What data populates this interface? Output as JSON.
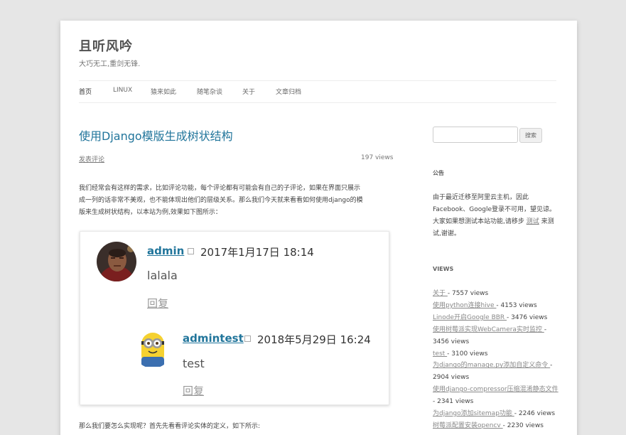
{
  "site": {
    "title": "且听风吟",
    "description": "大巧无工,重剑无锋."
  },
  "nav": [
    {
      "label": "首页"
    },
    {
      "label": "LINUX"
    },
    {
      "label": "猿来如此"
    },
    {
      "label": "随笔杂谈"
    },
    {
      "label": "关于"
    },
    {
      "label": "文章归档"
    }
  ],
  "post": {
    "title": "使用Django模版生成树状结构",
    "comments_link": "发表评论",
    "views": "197 views",
    "intro_lines": [
      "我们经常会有这样的需求，比如评论功能，每个评论都有可能会有自己的子评论，如果在界面只展示",
      "成一列的话非常不美观，也不能体现出他们的层级关系。那么我们今天就来看看如何使用django的模",
      "版来生成树状结构，以本站为例,效果如下图所示："
    ],
    "next_paragraph": "那么我们要怎么实现呢？首先先看看评论实体的定义，如下所示:"
  },
  "demo_comments": [
    {
      "author": "admin",
      "date": "2017年1月17日 18:14",
      "text": "lalala",
      "reply": "回复"
    },
    {
      "author": "admintest",
      "date": "2018年5月29日 16:24",
      "text": "test",
      "reply": "回复"
    }
  ],
  "sidebar": {
    "search_button": "搜索",
    "notice_title": "公告",
    "notice_lines": [
      "由于最近迁移至阿里云主机，因此",
      "Facebook、Google登录不可用，望见谅。"
    ],
    "notice_line3_prefix": "大家如果想测试本站功能,请移步 ",
    "notice_link": "测试",
    "notice_line3_suffix": " 来测",
    "notice_line4": "试,谢谢。",
    "views_title": "VIEWS",
    "views_items": [
      {
        "link": "关于 ",
        "count": " - 7557 views"
      },
      {
        "link": "使用python连接hive ",
        "count": " - 4153 views"
      },
      {
        "link": "Linode开启Google BBR ",
        "count": " - 3476 views"
      },
      {
        "link": "使用树莓派实现WebCamera实时监控 ",
        "count": " -"
      },
      {
        "link": "",
        "count": "3456 views"
      },
      {
        "link": "test ",
        "count": " - 3100 views"
      },
      {
        "link": "为django的manage.py添加自定义命令 ",
        "count": " -"
      },
      {
        "link": "",
        "count": "2904 views"
      },
      {
        "link": "使用django-compressor压缩混淆静态文件 ",
        "count": ""
      },
      {
        "link": "",
        "count": " - 2341 views"
      },
      {
        "link": "为django添加sitemap功能 ",
        "count": " - 2246 views"
      },
      {
        "link": "树莓派配置安装opencv ",
        "count": " - 2230 views"
      }
    ]
  }
}
